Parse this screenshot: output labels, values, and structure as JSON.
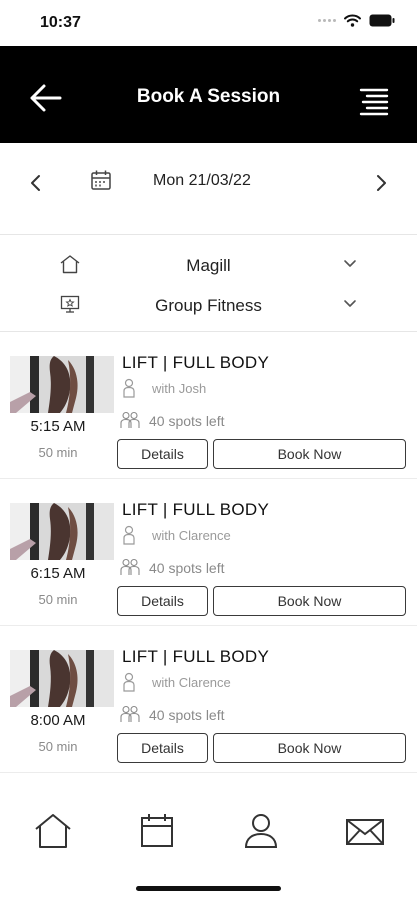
{
  "status_bar": {
    "time": "10:37"
  },
  "header": {
    "title": "Book A Session"
  },
  "date_nav": {
    "date": "Mon 21/03/22"
  },
  "filters": {
    "location": "Magill",
    "category": "Group Fitness"
  },
  "classes": [
    {
      "title": "LIFT | FULL BODY",
      "instructor": "with Josh",
      "spots": "40 spots left",
      "time": "5:15 AM",
      "duration": "50 min",
      "details_label": "Details",
      "book_label": "Book Now"
    },
    {
      "title": "LIFT | FULL BODY",
      "instructor": "with Clarence",
      "spots": "40 spots left",
      "time": "6:15 AM",
      "duration": "50 min",
      "details_label": "Details",
      "book_label": "Book Now"
    },
    {
      "title": "LIFT | FULL BODY",
      "instructor": "with Clarence",
      "spots": "40 spots left",
      "time": "8:00 AM",
      "duration": "50 min",
      "details_label": "Details",
      "book_label": "Book Now"
    }
  ],
  "bottom_nav": {
    "items": [
      "home-icon",
      "calendar-icon",
      "profile-icon",
      "mail-icon"
    ]
  },
  "colors": {
    "header_bg": "#000000",
    "accent": "#111111",
    "muted_text": "#8a8a8a"
  }
}
